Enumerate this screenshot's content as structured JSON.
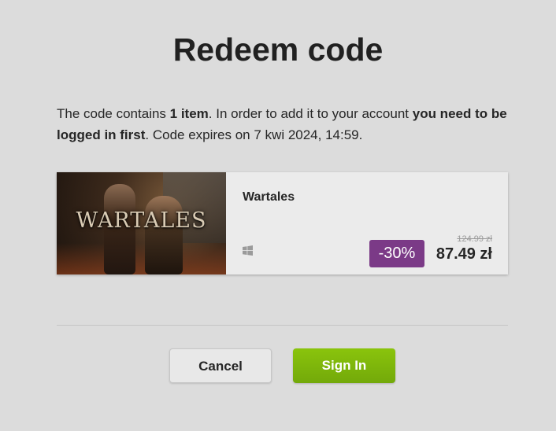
{
  "dialog": {
    "title": "Redeem code",
    "description": {
      "part1": "The code contains ",
      "item_count": "1 item",
      "part2": ". In order to add it to your account ",
      "login_required": "you need to be logged in first",
      "part3": ". Code expires on 7 kwi 2024, 14:59."
    }
  },
  "product": {
    "name": "Wartales",
    "cover_logo": "WARTALES",
    "platform_icon": "windows-icon",
    "discount": "-30%",
    "old_price": "124.99 zł",
    "price": "87.49 zł"
  },
  "buttons": {
    "cancel": "Cancel",
    "sign_in": "Sign In"
  },
  "colors": {
    "background": "#dcdcdc",
    "discount_badge": "#7b3a87",
    "sign_in_button": "#7fb80b"
  }
}
